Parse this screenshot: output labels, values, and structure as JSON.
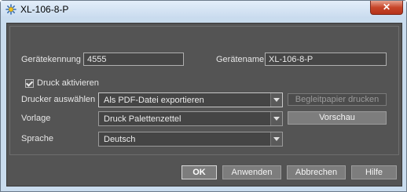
{
  "window": {
    "title": "XL-106-8-P",
    "close_label": "✕"
  },
  "form": {
    "device_id_label": "Gerätekennung",
    "device_id_value": "4555",
    "device_name_label": "Gerätename",
    "device_name_value": "XL-106-8-P",
    "print_enabled_label": "Druck aktivieren",
    "print_enabled_checked": true,
    "printer_label": "Drucker auswählen",
    "printer_value": "Als PDF-Datei exportieren",
    "cover_sheet_button": "Begleitpapier drucken",
    "template_label": "Vorlage",
    "template_value": "Druck Palettenzettel",
    "preview_button": "Vorschau",
    "language_label": "Sprache",
    "language_value": "Deutsch"
  },
  "footer": {
    "ok": "OK",
    "apply": "Anwenden",
    "cancel": "Abbrechen",
    "help": "Hilfe"
  }
}
